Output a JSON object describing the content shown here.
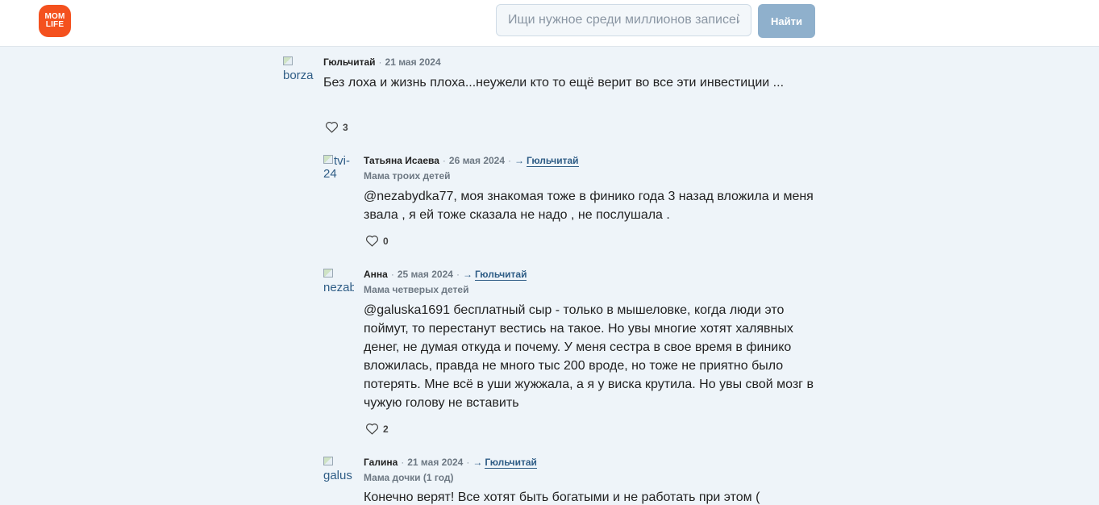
{
  "header": {
    "logo_line1": "MOM",
    "logo_line2": "LIFE",
    "search_placeholder": "Ищи нужное среди миллионов записей",
    "search_button": "Найти",
    "brand_color": "#f4511e"
  },
  "comments": [
    {
      "avatar_alt": "borza",
      "author": "Гюльчитай",
      "date": "21 мая 2024",
      "text": "Без лоха и жизнь плоха...неужели кто то ещё верит во все эти инвестиции ...",
      "likes": "3"
    },
    {
      "avatar_alt": "tvi-24",
      "author": "Татьяна Исаева",
      "date": "26 мая 2024",
      "reply_to": "Гюльчитай",
      "subtitle": "Мама троих детей",
      "text": "@nezabydka77, моя знакомая тоже в финико года 3 назад вложила и меня звала , я ей тоже сказала не надо , не послушала .",
      "likes": "0"
    },
    {
      "avatar_alt": "nezab",
      "author": "Анна",
      "date": "25 мая 2024",
      "reply_to": "Гюльчитай",
      "subtitle": "Мама четверых детей",
      "text": "@galuska1691 бесплатный сыр - только в мышеловке, когда люди это поймут, то перестанут вестись на такое. Но увы многие хотят халявных денег, не думая откуда и почему. У меня сестра в свое время в финико вложилась, правда не много тыс 200 вроде, но тоже не приятно было потерять. Мне всё в уши жужжала, а я у виска крутила. Но увы свой мозг в чужую голову не вставить",
      "likes": "2"
    },
    {
      "avatar_alt": "galus",
      "author": "Галина",
      "date": "21 мая 2024",
      "reply_to": "Гюльчитай",
      "subtitle": "Мама дочки (1 год)",
      "text": "Конечно верят! Все хотят быть богатыми и не работать при этом (",
      "likes": ""
    }
  ]
}
